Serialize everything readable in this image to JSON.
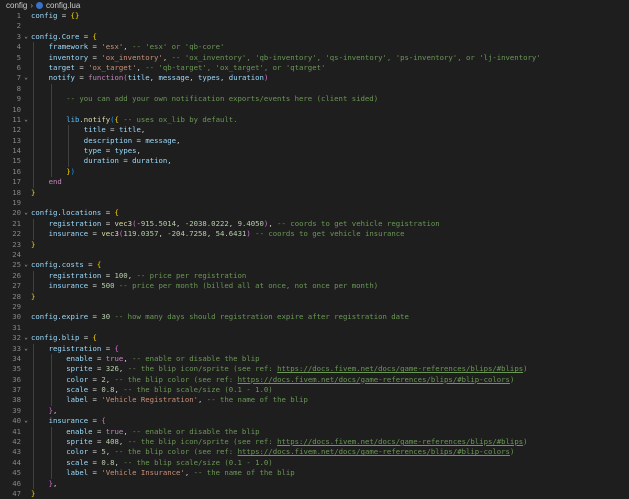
{
  "breadcrumb": {
    "folder": "config",
    "separator": "›",
    "file": "config.lua"
  },
  "lines": [
    {
      "n": "1",
      "fold": "",
      "indent": 0,
      "tokens": [
        {
          "t": "config",
          "c": "t-id"
        },
        {
          "t": " = ",
          "c": "t-op"
        },
        {
          "t": "{}",
          "c": "t-br1"
        }
      ]
    },
    {
      "n": "2",
      "fold": "",
      "indent": 0,
      "tokens": []
    },
    {
      "n": "3",
      "fold": "⌄",
      "indent": 0,
      "tokens": [
        {
          "t": "config",
          "c": "t-id"
        },
        {
          "t": ".",
          "c": "t-op"
        },
        {
          "t": "Core",
          "c": "t-id"
        },
        {
          "t": " = ",
          "c": "t-op"
        },
        {
          "t": "{",
          "c": "t-br1"
        }
      ]
    },
    {
      "n": "4",
      "fold": "",
      "indent": 1,
      "tokens": [
        {
          "t": "framework",
          "c": "t-id"
        },
        {
          "t": " = ",
          "c": "t-op"
        },
        {
          "t": "'esx'",
          "c": "t-str"
        },
        {
          "t": ", ",
          "c": "t-op"
        },
        {
          "t": "-- 'esx' or 'qb-core'",
          "c": "t-com"
        }
      ]
    },
    {
      "n": "5",
      "fold": "",
      "indent": 1,
      "tokens": [
        {
          "t": "inventory",
          "c": "t-id"
        },
        {
          "t": " = ",
          "c": "t-op"
        },
        {
          "t": "'ox_inventory'",
          "c": "t-str"
        },
        {
          "t": ", ",
          "c": "t-op"
        },
        {
          "t": "-- 'ox_inventory', 'qb-inventory', 'qs-inventory', 'ps-inventory', or 'lj-inventory'",
          "c": "t-com"
        }
      ]
    },
    {
      "n": "6",
      "fold": "",
      "indent": 1,
      "tokens": [
        {
          "t": "target",
          "c": "t-id"
        },
        {
          "t": " = ",
          "c": "t-op"
        },
        {
          "t": "'ox_target'",
          "c": "t-str"
        },
        {
          "t": ", ",
          "c": "t-op"
        },
        {
          "t": "-- 'qb-target', 'ox_target', or 'qtarget'",
          "c": "t-com"
        }
      ]
    },
    {
      "n": "7",
      "fold": "⌄",
      "indent": 1,
      "tokens": [
        {
          "t": "notify",
          "c": "t-id"
        },
        {
          "t": " = ",
          "c": "t-op"
        },
        {
          "t": "function",
          "c": "t-kw"
        },
        {
          "t": "(",
          "c": "t-br2"
        },
        {
          "t": "title",
          "c": "t-id"
        },
        {
          "t": ", ",
          "c": "t-op"
        },
        {
          "t": "message",
          "c": "t-id"
        },
        {
          "t": ", ",
          "c": "t-op"
        },
        {
          "t": "types",
          "c": "t-id"
        },
        {
          "t": ", ",
          "c": "t-op"
        },
        {
          "t": "duration",
          "c": "t-id"
        },
        {
          "t": ")",
          "c": "t-br2"
        }
      ]
    },
    {
      "n": "8",
      "fold": "",
      "indent": 2,
      "tokens": []
    },
    {
      "n": "9",
      "fold": "",
      "indent": 2,
      "tokens": [
        {
          "t": "-- you can add your own notification exports/events here (client sided)",
          "c": "t-com"
        }
      ]
    },
    {
      "n": "10",
      "fold": "",
      "indent": 2,
      "tokens": []
    },
    {
      "n": "11",
      "fold": "⌄",
      "indent": 2,
      "tokens": [
        {
          "t": "lib",
          "c": "t-var"
        },
        {
          "t": ".",
          "c": "t-op"
        },
        {
          "t": "notify",
          "c": "t-fn"
        },
        {
          "t": "(",
          "c": "t-br3"
        },
        {
          "t": "{",
          "c": "t-br1"
        },
        {
          "t": " -- uses ox_lib by default.",
          "c": "t-com"
        }
      ]
    },
    {
      "n": "12",
      "fold": "",
      "indent": 3,
      "tokens": [
        {
          "t": "title",
          "c": "t-id"
        },
        {
          "t": " = ",
          "c": "t-op"
        },
        {
          "t": "title",
          "c": "t-id"
        },
        {
          "t": ",",
          "c": "t-op"
        }
      ]
    },
    {
      "n": "13",
      "fold": "",
      "indent": 3,
      "tokens": [
        {
          "t": "description",
          "c": "t-id"
        },
        {
          "t": " = ",
          "c": "t-op"
        },
        {
          "t": "message",
          "c": "t-id"
        },
        {
          "t": ",",
          "c": "t-op"
        }
      ]
    },
    {
      "n": "14",
      "fold": "",
      "indent": 3,
      "tokens": [
        {
          "t": "type",
          "c": "t-id"
        },
        {
          "t": " = ",
          "c": "t-op"
        },
        {
          "t": "types",
          "c": "t-id"
        },
        {
          "t": ",",
          "c": "t-op"
        }
      ]
    },
    {
      "n": "15",
      "fold": "",
      "indent": 3,
      "tokens": [
        {
          "t": "duration",
          "c": "t-id"
        },
        {
          "t": " = ",
          "c": "t-op"
        },
        {
          "t": "duration",
          "c": "t-id"
        },
        {
          "t": ",",
          "c": "t-op"
        }
      ]
    },
    {
      "n": "16",
      "fold": "",
      "indent": 2,
      "tokens": [
        {
          "t": "}",
          "c": "t-br1"
        },
        {
          "t": ")",
          "c": "t-br3"
        }
      ]
    },
    {
      "n": "17",
      "fold": "",
      "indent": 1,
      "tokens": [
        {
          "t": "end",
          "c": "t-kw"
        }
      ]
    },
    {
      "n": "18",
      "fold": "",
      "indent": 0,
      "tokens": [
        {
          "t": "}",
          "c": "t-br1"
        }
      ]
    },
    {
      "n": "19",
      "fold": "",
      "indent": 0,
      "tokens": []
    },
    {
      "n": "20",
      "fold": "⌄",
      "indent": 0,
      "tokens": [
        {
          "t": "config",
          "c": "t-id"
        },
        {
          "t": ".",
          "c": "t-op"
        },
        {
          "t": "locations",
          "c": "t-id"
        },
        {
          "t": " = ",
          "c": "t-op"
        },
        {
          "t": "{",
          "c": "t-br1"
        }
      ]
    },
    {
      "n": "21",
      "fold": "",
      "indent": 1,
      "tokens": [
        {
          "t": "registration",
          "c": "t-id"
        },
        {
          "t": " = ",
          "c": "t-op"
        },
        {
          "t": "vec3",
          "c": "t-fn"
        },
        {
          "t": "(",
          "c": "t-br2"
        },
        {
          "t": "-915.5014",
          "c": "t-num"
        },
        {
          "t": ", ",
          "c": "t-op"
        },
        {
          "t": "-2038.0222",
          "c": "t-num"
        },
        {
          "t": ", ",
          "c": "t-op"
        },
        {
          "t": "9.4050",
          "c": "t-num"
        },
        {
          "t": ")",
          "c": "t-br2"
        },
        {
          "t": ", ",
          "c": "t-op"
        },
        {
          "t": "-- coords to get vehicle registration",
          "c": "t-com"
        }
      ]
    },
    {
      "n": "22",
      "fold": "",
      "indent": 1,
      "tokens": [
        {
          "t": "insurance",
          "c": "t-id"
        },
        {
          "t": " = ",
          "c": "t-op"
        },
        {
          "t": "vec3",
          "c": "t-fn"
        },
        {
          "t": "(",
          "c": "t-br2"
        },
        {
          "t": "119.0357",
          "c": "t-num"
        },
        {
          "t": ", ",
          "c": "t-op"
        },
        {
          "t": "-204.7258",
          "c": "t-num"
        },
        {
          "t": ", ",
          "c": "t-op"
        },
        {
          "t": "54.6431",
          "c": "t-num"
        },
        {
          "t": ")",
          "c": "t-br2"
        },
        {
          "t": " -- coords to get vehicle insurance",
          "c": "t-com"
        }
      ]
    },
    {
      "n": "23",
      "fold": "",
      "indent": 0,
      "tokens": [
        {
          "t": "}",
          "c": "t-br1"
        }
      ]
    },
    {
      "n": "24",
      "fold": "",
      "indent": 0,
      "tokens": []
    },
    {
      "n": "25",
      "fold": "⌄",
      "indent": 0,
      "tokens": [
        {
          "t": "config",
          "c": "t-id"
        },
        {
          "t": ".",
          "c": "t-op"
        },
        {
          "t": "costs",
          "c": "t-id"
        },
        {
          "t": " = ",
          "c": "t-op"
        },
        {
          "t": "{",
          "c": "t-br1"
        }
      ]
    },
    {
      "n": "26",
      "fold": "",
      "indent": 1,
      "tokens": [
        {
          "t": "registration",
          "c": "t-id"
        },
        {
          "t": " = ",
          "c": "t-op"
        },
        {
          "t": "100",
          "c": "t-num"
        },
        {
          "t": ", ",
          "c": "t-op"
        },
        {
          "t": "-- price per registration",
          "c": "t-com"
        }
      ]
    },
    {
      "n": "27",
      "fold": "",
      "indent": 1,
      "tokens": [
        {
          "t": "insurance",
          "c": "t-id"
        },
        {
          "t": " = ",
          "c": "t-op"
        },
        {
          "t": "500",
          "c": "t-num"
        },
        {
          "t": " -- price per month (billed all at once, not once per month)",
          "c": "t-com"
        }
      ]
    },
    {
      "n": "28",
      "fold": "",
      "indent": 0,
      "tokens": [
        {
          "t": "}",
          "c": "t-br1"
        }
      ]
    },
    {
      "n": "29",
      "fold": "",
      "indent": 0,
      "tokens": []
    },
    {
      "n": "30",
      "fold": "",
      "indent": 0,
      "tokens": [
        {
          "t": "config",
          "c": "t-id"
        },
        {
          "t": ".",
          "c": "t-op"
        },
        {
          "t": "expire",
          "c": "t-id"
        },
        {
          "t": " = ",
          "c": "t-op"
        },
        {
          "t": "30",
          "c": "t-num"
        },
        {
          "t": " -- how many days should registration expire after registration date",
          "c": "t-com"
        }
      ]
    },
    {
      "n": "31",
      "fold": "",
      "indent": 0,
      "tokens": []
    },
    {
      "n": "32",
      "fold": "⌄",
      "indent": 0,
      "tokens": [
        {
          "t": "config",
          "c": "t-id"
        },
        {
          "t": ".",
          "c": "t-op"
        },
        {
          "t": "blip",
          "c": "t-id"
        },
        {
          "t": " = ",
          "c": "t-op"
        },
        {
          "t": "{",
          "c": "t-br1"
        }
      ]
    },
    {
      "n": "33",
      "fold": "⌄",
      "indent": 1,
      "tokens": [
        {
          "t": "registration",
          "c": "t-id"
        },
        {
          "t": " = ",
          "c": "t-op"
        },
        {
          "t": "{",
          "c": "t-br2"
        }
      ]
    },
    {
      "n": "34",
      "fold": "",
      "indent": 2,
      "tokens": [
        {
          "t": "enable",
          "c": "t-id"
        },
        {
          "t": " = ",
          "c": "t-op"
        },
        {
          "t": "true",
          "c": "t-kw"
        },
        {
          "t": ", ",
          "c": "t-op"
        },
        {
          "t": "-- enable or disable the blip",
          "c": "t-com"
        }
      ]
    },
    {
      "n": "35",
      "fold": "",
      "indent": 2,
      "tokens": [
        {
          "t": "sprite",
          "c": "t-id"
        },
        {
          "t": " = ",
          "c": "t-op"
        },
        {
          "t": "326",
          "c": "t-num"
        },
        {
          "t": ", ",
          "c": "t-op"
        },
        {
          "t": "-- the blip icon/sprite (see ref: ",
          "c": "t-com"
        },
        {
          "t": "https://docs.fivem.net/docs/game-references/blips/#blips",
          "c": "t-link"
        },
        {
          "t": ")",
          "c": "t-com"
        }
      ]
    },
    {
      "n": "36",
      "fold": "",
      "indent": 2,
      "tokens": [
        {
          "t": "color",
          "c": "t-id"
        },
        {
          "t": " = ",
          "c": "t-op"
        },
        {
          "t": "2",
          "c": "t-num"
        },
        {
          "t": ", ",
          "c": "t-op"
        },
        {
          "t": "-- the blip color (see ref: ",
          "c": "t-com"
        },
        {
          "t": "https://docs.fivem.net/docs/game-references/blips/#blip-colors",
          "c": "t-link"
        },
        {
          "t": ")",
          "c": "t-com"
        }
      ]
    },
    {
      "n": "37",
      "fold": "",
      "indent": 2,
      "tokens": [
        {
          "t": "scale",
          "c": "t-id"
        },
        {
          "t": " = ",
          "c": "t-op"
        },
        {
          "t": "0.8",
          "c": "t-num"
        },
        {
          "t": ", ",
          "c": "t-op"
        },
        {
          "t": "-- the blip scale/size (0.1 - 1.0)",
          "c": "t-com"
        }
      ]
    },
    {
      "n": "38",
      "fold": "",
      "indent": 2,
      "tokens": [
        {
          "t": "label",
          "c": "t-id"
        },
        {
          "t": " = ",
          "c": "t-op"
        },
        {
          "t": "'Vehicle Registration'",
          "c": "t-str"
        },
        {
          "t": ", ",
          "c": "t-op"
        },
        {
          "t": "-- the name of the blip",
          "c": "t-com"
        }
      ]
    },
    {
      "n": "39",
      "fold": "",
      "indent": 1,
      "tokens": [
        {
          "t": "}",
          "c": "t-br2"
        },
        {
          "t": ",",
          "c": "t-op"
        }
      ]
    },
    {
      "n": "40",
      "fold": "⌄",
      "indent": 1,
      "tokens": [
        {
          "t": "insurance",
          "c": "t-id"
        },
        {
          "t": " = ",
          "c": "t-op"
        },
        {
          "t": "{",
          "c": "t-br2"
        }
      ]
    },
    {
      "n": "41",
      "fold": "",
      "indent": 2,
      "tokens": [
        {
          "t": "enable",
          "c": "t-id"
        },
        {
          "t": " = ",
          "c": "t-op"
        },
        {
          "t": "true",
          "c": "t-kw"
        },
        {
          "t": ", ",
          "c": "t-op"
        },
        {
          "t": "-- enable or disable the blip",
          "c": "t-com"
        }
      ]
    },
    {
      "n": "42",
      "fold": "",
      "indent": 2,
      "tokens": [
        {
          "t": "sprite",
          "c": "t-id"
        },
        {
          "t": " = ",
          "c": "t-op"
        },
        {
          "t": "408",
          "c": "t-num"
        },
        {
          "t": ", ",
          "c": "t-op"
        },
        {
          "t": "-- the blip icon/sprite (see ref: ",
          "c": "t-com"
        },
        {
          "t": "https://docs.fivem.net/docs/game-references/blips/#blips",
          "c": "t-link"
        },
        {
          "t": ")",
          "c": "t-com"
        }
      ]
    },
    {
      "n": "43",
      "fold": "",
      "indent": 2,
      "tokens": [
        {
          "t": "color",
          "c": "t-id"
        },
        {
          "t": " = ",
          "c": "t-op"
        },
        {
          "t": "5",
          "c": "t-num"
        },
        {
          "t": ", ",
          "c": "t-op"
        },
        {
          "t": "-- the blip color (see ref: ",
          "c": "t-com"
        },
        {
          "t": "https://docs.fivem.net/docs/game-references/blips/#blip-colors",
          "c": "t-link"
        },
        {
          "t": ")",
          "c": "t-com"
        }
      ]
    },
    {
      "n": "44",
      "fold": "",
      "indent": 2,
      "tokens": [
        {
          "t": "scale",
          "c": "t-id"
        },
        {
          "t": " = ",
          "c": "t-op"
        },
        {
          "t": "0.8",
          "c": "t-num"
        },
        {
          "t": ", ",
          "c": "t-op"
        },
        {
          "t": "-- the blip scale/size (0.1 - 1.0)",
          "c": "t-com"
        }
      ]
    },
    {
      "n": "45",
      "fold": "",
      "indent": 2,
      "tokens": [
        {
          "t": "label",
          "c": "t-id"
        },
        {
          "t": " = ",
          "c": "t-op"
        },
        {
          "t": "'Vehicle Insurance'",
          "c": "t-str"
        },
        {
          "t": ", ",
          "c": "t-op"
        },
        {
          "t": "-- the name of the blip",
          "c": "t-com"
        }
      ]
    },
    {
      "n": "46",
      "fold": "",
      "indent": 1,
      "tokens": [
        {
          "t": "}",
          "c": "t-br2"
        },
        {
          "t": ",",
          "c": "t-op"
        }
      ]
    },
    {
      "n": "47",
      "fold": "",
      "indent": 0,
      "tokens": [
        {
          "t": "}",
          "c": "t-br1"
        }
      ]
    }
  ]
}
